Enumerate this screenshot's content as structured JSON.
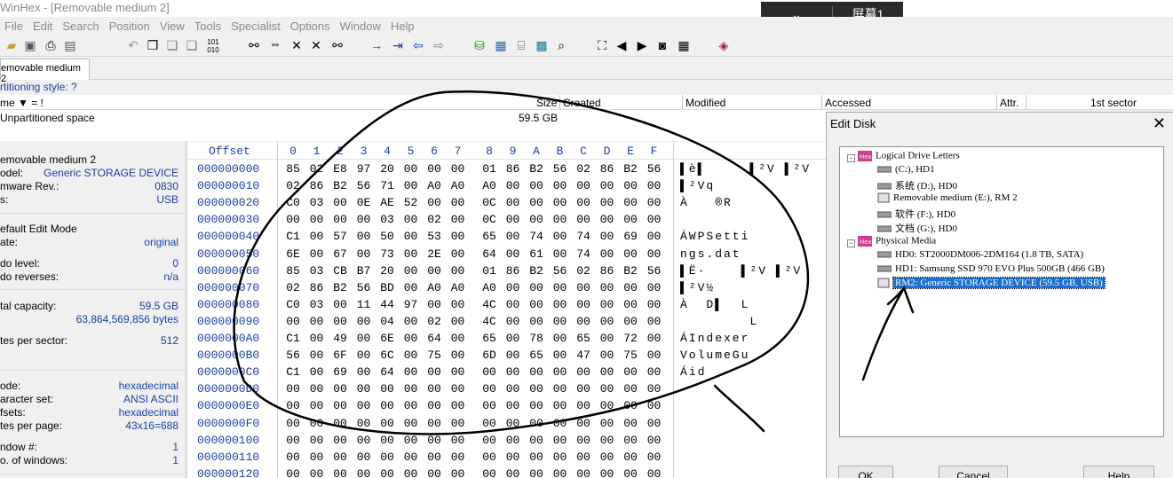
{
  "window": {
    "title": "WinHex - [Removable medium 2]"
  },
  "ime": {
    "chevron": "⌄",
    "label": "屏幕1"
  },
  "menu": [
    "File",
    "Edit",
    "Search",
    "Position",
    "View",
    "Tools",
    "Specialist",
    "Options",
    "Window",
    "Help"
  ],
  "tab": {
    "label": "emovable medium 2"
  },
  "partition_style": "rtitioning style: ?",
  "dir": {
    "headers": {
      "name": "me ▼ = !",
      "size": "Size",
      "created": "Created",
      "modified": "Modified",
      "accessed": "Accessed",
      "attr": "Attr.",
      "first_sector": "1st sector"
    },
    "rows": [
      {
        "name": "Unpartitioned space",
        "size": "59.5 GB"
      }
    ]
  },
  "info": {
    "device": "emovable medium 2",
    "model_label": "odel:",
    "model": "Generic STORAGE DEVICE",
    "firmware_label": "mware Rev.:",
    "firmware": "0830",
    "bus_label": "s:",
    "bus": "USB",
    "edit_mode_label": "efault Edit Mode",
    "state_label": "ate:",
    "state": "original",
    "undo_level_label": "do level:",
    "undo_level": "0",
    "undo_rev_label": "do reverses:",
    "undo_rev": "n/a",
    "capacity_label": "tal capacity:",
    "capacity": "59.5 GB",
    "capacity_bytes": "63,864,569,856 bytes",
    "bps_label": "tes per sector:",
    "bps": "512",
    "mode_label": "ode:",
    "mode": "hexadecimal",
    "charset_label": "aracter set:",
    "charset": "ANSI ASCII",
    "offsets_label": "fsets:",
    "offsets": "hexadecimal",
    "bpp_label": "tes per page:",
    "bpp": "43x16=688",
    "window_no_label": "ndow #:",
    "window_no": "1",
    "windows_label": "o. of windows:",
    "windows": "1"
  },
  "hex": {
    "offset_header": "Offset",
    "col_headers": [
      "0",
      "1",
      "2",
      "3",
      "4",
      "5",
      "6",
      "7",
      "8",
      "9",
      "A",
      "B",
      "C",
      "D",
      "E",
      "F"
    ],
    "rows": [
      {
        "offset": "000000000",
        "bytes": [
          "85",
          "02",
          "E8",
          "97",
          "20",
          "00",
          "00",
          "00",
          "01",
          "86",
          "B2",
          "56",
          "02",
          "86",
          "B2",
          "56"
        ],
        "ascii": "▌è▌     ▌²V ▌²V"
      },
      {
        "offset": "000000010",
        "bytes": [
          "02",
          "86",
          "B2",
          "56",
          "71",
          "00",
          "A0",
          "A0",
          "A0",
          "00",
          "00",
          "00",
          "00",
          "00",
          "00",
          "00"
        ],
        "ascii": "▌²Vq"
      },
      {
        "offset": "000000020",
        "bytes": [
          "C0",
          "03",
          "00",
          "0E",
          "AE",
          "52",
          "00",
          "00",
          "0C",
          "00",
          "00",
          "00",
          "00",
          "00",
          "00",
          "00"
        ],
        "ascii": "À   ®R"
      },
      {
        "offset": "000000030",
        "bytes": [
          "00",
          "00",
          "00",
          "00",
          "03",
          "00",
          "02",
          "00",
          "0C",
          "00",
          "00",
          "00",
          "00",
          "00",
          "00",
          "00"
        ],
        "ascii": ""
      },
      {
        "offset": "000000040",
        "bytes": [
          "C1",
          "00",
          "57",
          "00",
          "50",
          "00",
          "53",
          "00",
          "65",
          "00",
          "74",
          "00",
          "74",
          "00",
          "69",
          "00"
        ],
        "ascii": "ÁWPSetti"
      },
      {
        "offset": "000000050",
        "bytes": [
          "6E",
          "00",
          "67",
          "00",
          "73",
          "00",
          "2E",
          "00",
          "64",
          "00",
          "61",
          "00",
          "74",
          "00",
          "00",
          "00"
        ],
        "ascii": "ngs.dat"
      },
      {
        "offset": "000000060",
        "bytes": [
          "85",
          "03",
          "CB",
          "B7",
          "20",
          "00",
          "00",
          "00",
          "01",
          "86",
          "B2",
          "56",
          "02",
          "86",
          "B2",
          "56"
        ],
        "ascii": "▌Ë·    ▌²V ▌²V"
      },
      {
        "offset": "000000070",
        "bytes": [
          "02",
          "86",
          "B2",
          "56",
          "BD",
          "00",
          "A0",
          "A0",
          "A0",
          "00",
          "00",
          "00",
          "00",
          "00",
          "00",
          "00"
        ],
        "ascii": "▌²V½"
      },
      {
        "offset": "000000080",
        "bytes": [
          "C0",
          "03",
          "00",
          "11",
          "44",
          "97",
          "00",
          "00",
          "4C",
          "00",
          "00",
          "00",
          "00",
          "00",
          "00",
          "00"
        ],
        "ascii": "À  D▌  L"
      },
      {
        "offset": "000000090",
        "bytes": [
          "00",
          "00",
          "00",
          "00",
          "04",
          "00",
          "02",
          "00",
          "4C",
          "00",
          "00",
          "00",
          "00",
          "00",
          "00",
          "00"
        ],
        "ascii": "        L"
      },
      {
        "offset": "0000000A0",
        "bytes": [
          "C1",
          "00",
          "49",
          "00",
          "6E",
          "00",
          "64",
          "00",
          "65",
          "00",
          "78",
          "00",
          "65",
          "00",
          "72",
          "00"
        ],
        "ascii": "ÁIndexer"
      },
      {
        "offset": "0000000B0",
        "bytes": [
          "56",
          "00",
          "6F",
          "00",
          "6C",
          "00",
          "75",
          "00",
          "6D",
          "00",
          "65",
          "00",
          "47",
          "00",
          "75",
          "00"
        ],
        "ascii": "VolumeGu"
      },
      {
        "offset": "0000000C0",
        "bytes": [
          "C1",
          "00",
          "69",
          "00",
          "64",
          "00",
          "00",
          "00",
          "00",
          "00",
          "00",
          "00",
          "00",
          "00",
          "00",
          "00"
        ],
        "ascii": "Áid"
      },
      {
        "offset": "0000000D0",
        "bytes": [
          "00",
          "00",
          "00",
          "00",
          "00",
          "00",
          "00",
          "00",
          "00",
          "00",
          "00",
          "00",
          "00",
          "00",
          "00",
          "00"
        ],
        "ascii": ""
      },
      {
        "offset": "0000000E0",
        "bytes": [
          "00",
          "00",
          "00",
          "00",
          "00",
          "00",
          "00",
          "00",
          "00",
          "00",
          "00",
          "00",
          "00",
          "00",
          "00",
          "00"
        ],
        "ascii": ""
      },
      {
        "offset": "0000000F0",
        "bytes": [
          "00",
          "00",
          "00",
          "00",
          "00",
          "00",
          "00",
          "00",
          "00",
          "00",
          "00",
          "00",
          "00",
          "00",
          "00",
          "00"
        ],
        "ascii": ""
      },
      {
        "offset": "000000100",
        "bytes": [
          "00",
          "00",
          "00",
          "00",
          "00",
          "00",
          "00",
          "00",
          "00",
          "00",
          "00",
          "00",
          "00",
          "00",
          "00",
          "00"
        ],
        "ascii": ""
      },
      {
        "offset": "000000110",
        "bytes": [
          "00",
          "00",
          "00",
          "00",
          "00",
          "00",
          "00",
          "00",
          "00",
          "00",
          "00",
          "00",
          "00",
          "00",
          "00",
          "00"
        ],
        "ascii": ""
      },
      {
        "offset": "000000120",
        "bytes": [
          "00",
          "00",
          "00",
          "00",
          "00",
          "00",
          "00",
          "00",
          "00",
          "00",
          "00",
          "00",
          "00",
          "00",
          "00",
          "00"
        ],
        "ascii": ""
      }
    ]
  },
  "edit_disk": {
    "title": "Edit Disk",
    "close": "✕",
    "groups": [
      {
        "label": "Logical Drive Letters",
        "items": [
          "(C:), HD1",
          "系统 (D:), HD0",
          "Removable medium (E:), RM 2",
          "软件 (F:), HD0",
          "文档 (G:), HD0"
        ]
      },
      {
        "label": "Physical Media",
        "items": [
          "HD0: ST2000DM006-2DM164 (1.8 TB, SATA)",
          "HD1: Samsung SSD 970 EVO Plus 500GB (466 GB)",
          "RM2: Generic STORAGE DEVICE (59.5 GB, USB)"
        ]
      }
    ],
    "selected": "RM2: Generic STORAGE DEVICE (59.5 GB, USB)",
    "buttons": {
      "ok": "OK",
      "cancel": "Cancel",
      "help": "Help"
    }
  },
  "icons": [
    "open-icon",
    "save-icon",
    "print-icon",
    "properties-icon",
    "undo-icon",
    "copy-icon",
    "paste-icon",
    "binary-icon",
    "find-icon",
    "find-hex-icon",
    "replace-icon",
    "replace-hex-icon",
    "find-next-icon",
    "goto-offset-icon",
    "goto-sector-icon",
    "back-icon",
    "forward-icon",
    "disk-icon",
    "ram-icon",
    "hdd-icon",
    "calc-icon",
    "search-icon",
    "binoculars-icon",
    "prev-icon",
    "next-icon",
    "snapshot-icon",
    "grid-icon",
    "book-icon"
  ]
}
